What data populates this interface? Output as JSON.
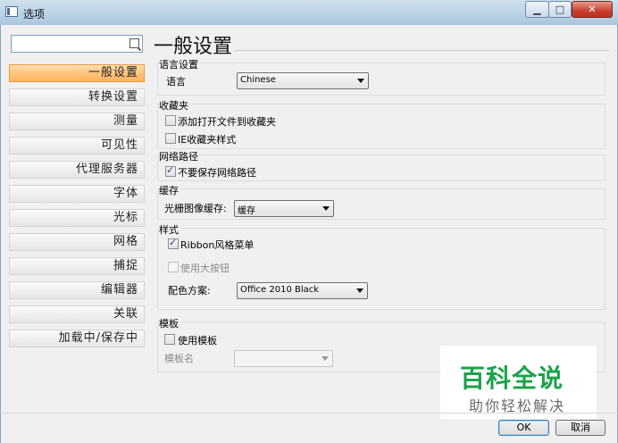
{
  "window": {
    "title": "选项",
    "close_glyph": "✕",
    "min_glyph": "▁",
    "max_glyph": "□"
  },
  "nav": {
    "search_placeholder": "",
    "items": [
      {
        "label": "一般设置",
        "active": true
      },
      {
        "label": "转换设置",
        "active": false
      },
      {
        "label": "测量",
        "active": false
      },
      {
        "label": "可见性",
        "active": false
      },
      {
        "label": "代理服务器",
        "active": false
      },
      {
        "label": "字体",
        "active": false
      },
      {
        "label": "光标",
        "active": false
      },
      {
        "label": "网格",
        "active": false
      },
      {
        "label": "捕捉",
        "active": false
      },
      {
        "label": "编辑器",
        "active": false
      },
      {
        "label": "关联",
        "active": false
      },
      {
        "label": "加载中/保存中",
        "active": false
      }
    ]
  },
  "page_title": "一般设置",
  "language": {
    "group": "语言设置",
    "label": "语言",
    "value": "Chinese"
  },
  "favorites": {
    "group": "收藏夹",
    "add_open_files": {
      "label": "添加打开文件到收藏夹",
      "checked": false
    },
    "ie_style": {
      "label": "IE收藏夹样式",
      "checked": false
    }
  },
  "network": {
    "group": "网络路径",
    "no_save": {
      "label": "不要保存网络路径",
      "checked": true
    }
  },
  "cache": {
    "group": "缓存",
    "label": "光栅图像缓存:",
    "value": "缓存"
  },
  "style": {
    "group": "样式",
    "ribbon": {
      "label": "Ribbon风格菜单",
      "checked": true
    },
    "large_buttons": {
      "label": "使用大按钮",
      "checked": false,
      "disabled": true
    },
    "color_label": "配色方案:",
    "color_value": "Office 2010 Black"
  },
  "template": {
    "group": "模板",
    "use": {
      "label": "使用模板",
      "checked": false
    },
    "name_label": "模板名",
    "name_value": ""
  },
  "watermark": {
    "main": "百科全说",
    "sub": "助你轻松解决"
  },
  "buttons": {
    "ok": "OK",
    "cancel": "取消"
  },
  "colors": {
    "active_nav": "#ffc47e",
    "watermark_green": "#1aa34a"
  }
}
